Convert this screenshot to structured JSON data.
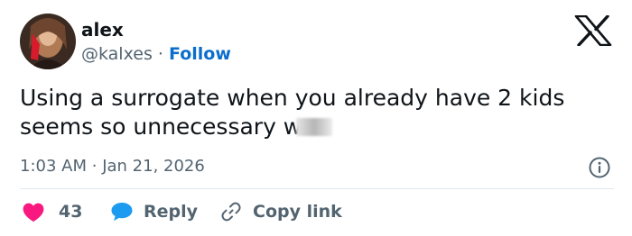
{
  "author": {
    "display_name": "alex",
    "handle": "@kalxes",
    "separator": "·",
    "follow_label": "Follow"
  },
  "tweet": {
    "text": "Using a surrogate when you already have 2 kids",
    "text_line2": "seems so unnecessary w",
    "time": "1:03 AM",
    "separator": "·",
    "date": "Jan 21, 2026"
  },
  "actions": {
    "like_count": "43",
    "reply_label": "Reply",
    "copy_label": "Copy link"
  },
  "icons": {
    "logo": "x-logo-icon",
    "info": "info-icon",
    "like": "heart-icon",
    "reply": "speech-bubble-icon",
    "copy": "link-icon"
  },
  "colors": {
    "like": "#f91880",
    "reply": "#1d9bf0",
    "follow": "#0c6ecc",
    "secondary_text": "#536471"
  }
}
